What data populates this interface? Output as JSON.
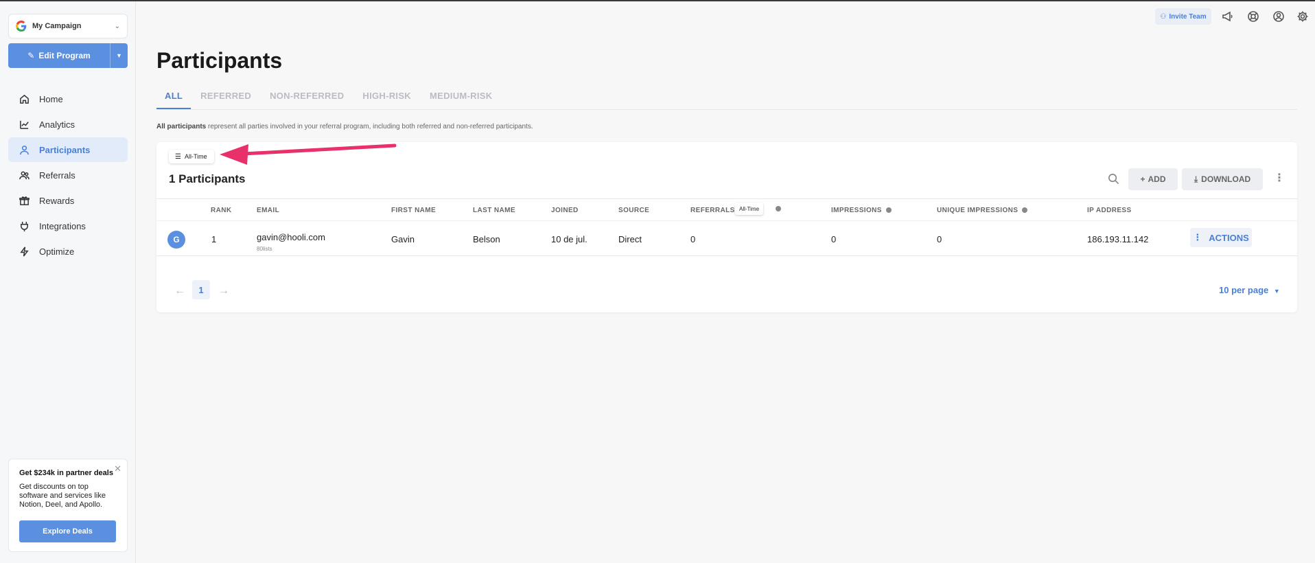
{
  "campaign": {
    "name": "My Campaign"
  },
  "sidebar": {
    "edit_label": "Edit Program",
    "items": [
      {
        "label": "Home",
        "icon": "home-icon"
      },
      {
        "label": "Analytics",
        "icon": "analytics-icon"
      },
      {
        "label": "Participants",
        "icon": "user-icon"
      },
      {
        "label": "Referrals",
        "icon": "users-icon"
      },
      {
        "label": "Rewards",
        "icon": "gift-icon"
      },
      {
        "label": "Integrations",
        "icon": "plug-icon"
      },
      {
        "label": "Optimize",
        "icon": "bolt-icon"
      }
    ],
    "active": "Participants"
  },
  "promo": {
    "title": "Get $234k in partner deals",
    "text": "Get discounts on top software and services like Notion, Deel, and Apollo.",
    "button": "Explore Deals"
  },
  "topbar": {
    "invite_label": "Invite Team"
  },
  "page": {
    "title": "Participants",
    "tabs": [
      "ALL",
      "REFERRED",
      "NON-REFERRED",
      "HIGH-RISK",
      "MEDIUM-RISK"
    ],
    "desc_bold": "All participants",
    "desc_rest": " represent all parties involved in your referral program, including both referred and non-referred participants."
  },
  "table": {
    "filter_label": "All-Time",
    "count_label": "1 Participants",
    "add_label": "ADD",
    "download_label": "DOWNLOAD",
    "columns": [
      "RANK",
      "EMAIL",
      "FIRST NAME",
      "LAST NAME",
      "JOINED",
      "SOURCE",
      "REFERRALS",
      "IMPRESSIONS",
      "UNIQUE IMPRESSIONS",
      "IP ADDRESS"
    ],
    "referrals_badge": "All-Time",
    "rows": [
      {
        "avatar": "G",
        "rank": "1",
        "email": "gavin@hooli.com",
        "email_sub": "80lists",
        "first_name": "Gavin",
        "last_name": "Belson",
        "joined": "10 de jul.",
        "source": "Direct",
        "referrals": "0",
        "impressions": "0",
        "unique_impressions": "0",
        "ip": "186.193.11.142",
        "actions_label": "ACTIONS"
      }
    ],
    "page": "1",
    "per_page": "10 per page"
  },
  "colors": {
    "accent": "#5b8fe0",
    "arrow": "#e8306a"
  }
}
